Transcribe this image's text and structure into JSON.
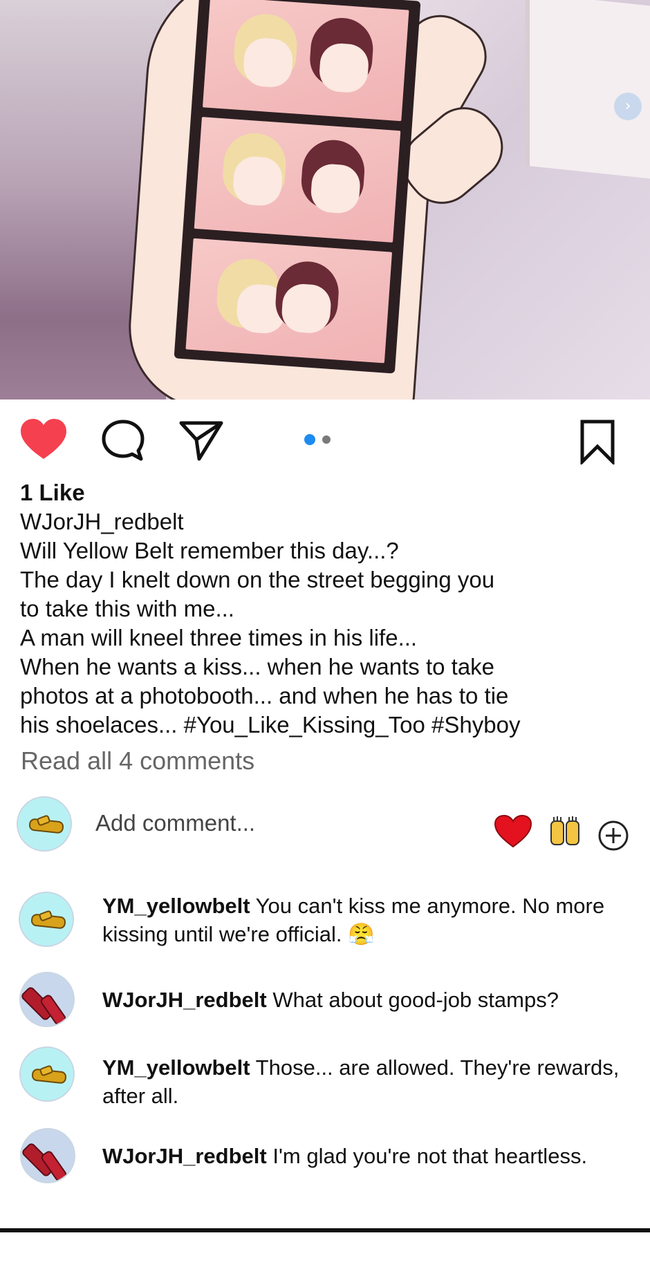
{
  "post": {
    "likes_label": "1 Like",
    "owner": "WJorJH_redbelt",
    "caption_lines": [
      "Will Yellow Belt remember this day...?",
      "The day I knelt down on the street begging you",
      "to take this with me...",
      "A man will kneel three times in his life...",
      "When he wants a kiss... when he wants to take",
      "photos at a photobooth... and when he has to tie",
      "his shoelaces... #You_Like_Kissing_Too #Shyboy"
    ],
    "read_all_comments": "Read all 4 comments",
    "carousel": {
      "count": 2,
      "active_index": 0
    }
  },
  "add_comment": {
    "placeholder": "Add comment...",
    "quick_reactions": [
      "heart-emoji",
      "raised-hands-emoji",
      "plus-icon"
    ]
  },
  "comments": [
    {
      "user": "YM_yellowbelt",
      "text": "You can't kiss me anymore. No more kissing until we're official. 😤",
      "avatar": "yellow-belt"
    },
    {
      "user": "WJorJH_redbelt",
      "text": "What about good-job stamps?",
      "avatar": "red-belt"
    },
    {
      "user": "YM_yellowbelt",
      "text": "Those... are allowed. They're rewards, after all.",
      "avatar": "yellow-belt"
    },
    {
      "user": "WJorJH_redbelt",
      "text": "I'm glad you're not that heartless.",
      "avatar": "red-belt"
    }
  ],
  "colors": {
    "like_heart": "#f5404f",
    "carousel_active": "#1d8bf0",
    "carousel_inactive": "#7a7a7a",
    "avatar_yellow_bg": "#b8f1f4",
    "avatar_red_bg": "#c9d7ec"
  }
}
